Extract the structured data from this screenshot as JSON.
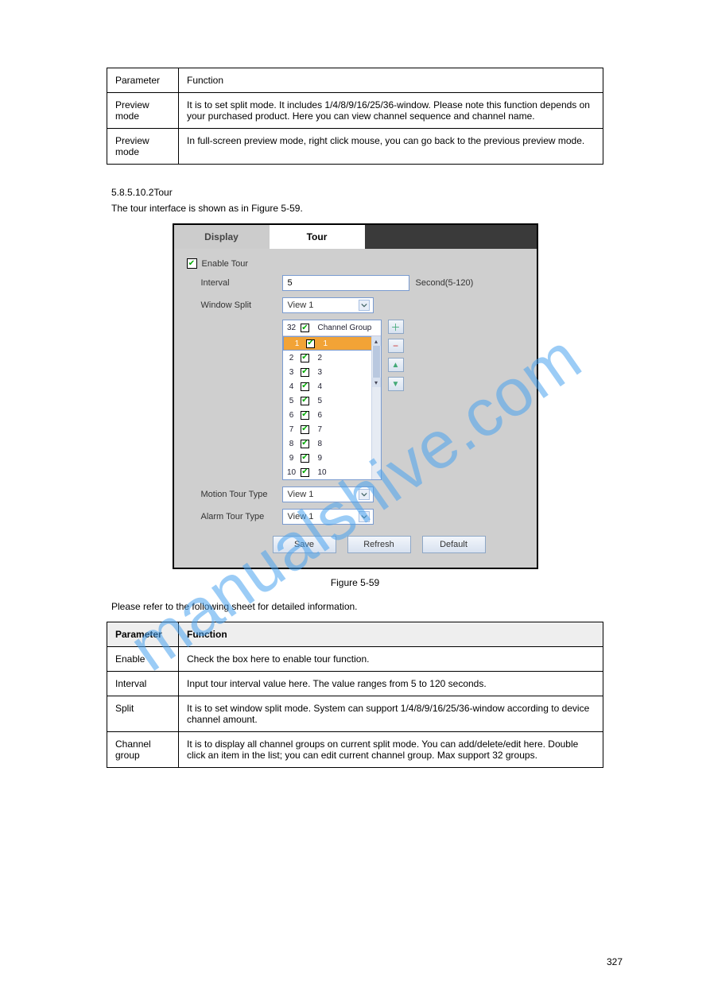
{
  "watermark": "manualshive.com",
  "table1": {
    "rows": [
      [
        "Parameter",
        "Function"
      ],
      [
        "Preview mode",
        "It is to set split mode. It includes 1/4/8/9/16/25/36-window. Please note this function depends on your purchased product. Here you can view channel sequence and channel name."
      ],
      [
        "Preview mode",
        "In full-screen preview mode, right click mouse, you can go back to the previous preview mode."
      ]
    ]
  },
  "section": {
    "heading": "5.8.5.10.2Tour",
    "body": "The tour interface is shown as in Figure 5-59."
  },
  "screenshot": {
    "tabs": {
      "inactive": "Display",
      "active": "Tour"
    },
    "enable_tour": "Enable Tour",
    "interval_label": "Interval",
    "interval_value": "5",
    "interval_suffix": "Second(5-120)",
    "window_split_label": "Window Split",
    "window_split_value": "View 1",
    "list_header_count": "32",
    "list_header_col": "Channel Group",
    "rows": [
      {
        "n": "1",
        "t": "1",
        "sel": true
      },
      {
        "n": "2",
        "t": "2"
      },
      {
        "n": "3",
        "t": "3"
      },
      {
        "n": "4",
        "t": "4"
      },
      {
        "n": "5",
        "t": "5"
      },
      {
        "n": "6",
        "t": "6"
      },
      {
        "n": "7",
        "t": "7"
      },
      {
        "n": "8",
        "t": "8"
      },
      {
        "n": "9",
        "t": "9"
      },
      {
        "n": "10",
        "t": "10"
      }
    ],
    "motion_tour_label": "Motion Tour Type",
    "motion_tour_value": "View 1",
    "alarm_tour_label": "Alarm Tour Type",
    "alarm_tour_value": "View 1",
    "buttons": {
      "save": "Save",
      "refresh": "Refresh",
      "default": "Default"
    }
  },
  "figure_caption": "Figure 5-59",
  "intro2": "Please refer to the following sheet for detailed information.",
  "table2": {
    "headers": [
      "Parameter",
      "Function"
    ],
    "rows": [
      [
        "Enable",
        "Check the box here to enable tour function."
      ],
      [
        "Interval",
        "Input tour interval value here. The value ranges from 5 to 120 seconds."
      ],
      [
        "Split",
        "It is to set window split mode. System can support 1/4/8/9/16/25/36-window according to device channel amount."
      ],
      [
        "Channel group",
        "It is to display all channel groups on current split mode. You can add/delete/edit here. Double click an item in the list; you can edit current channel group. Max support 32 groups."
      ]
    ]
  },
  "page_number": "327"
}
